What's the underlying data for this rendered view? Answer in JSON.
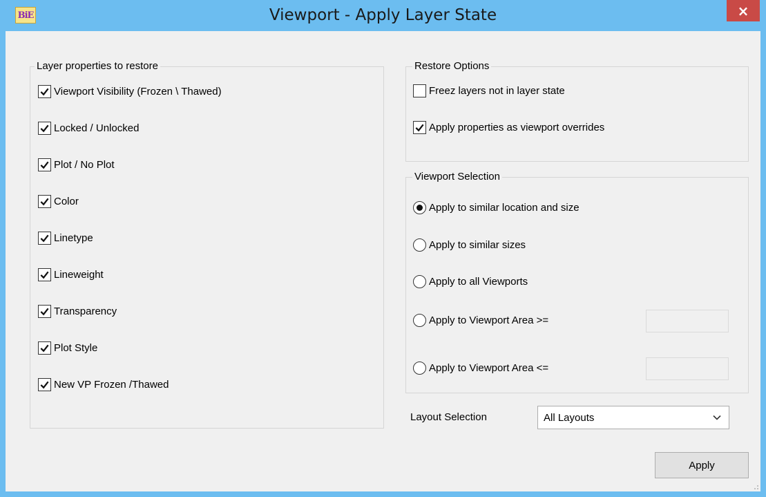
{
  "window": {
    "title": "Viewport - Apply Layer State",
    "app_icon_text": "BiE",
    "close_glyph": "×"
  },
  "layer_properties": {
    "title": "Layer properties to restore",
    "items": [
      {
        "label": "Viewport Visibility (Frozen \\ Thawed)",
        "checked": true
      },
      {
        "label": "Locked / Unlocked",
        "checked": true
      },
      {
        "label": "Plot / No Plot",
        "checked": true
      },
      {
        "label": "Color",
        "checked": true
      },
      {
        "label": "Linetype",
        "checked": true
      },
      {
        "label": "Lineweight",
        "checked": true
      },
      {
        "label": "Transparency",
        "checked": true
      },
      {
        "label": "Plot Style",
        "checked": true
      },
      {
        "label": "New VP Frozen /Thawed",
        "checked": true
      }
    ]
  },
  "restore_options": {
    "title": "Restore Options",
    "items": [
      {
        "label": "Freez layers not in layer state",
        "checked": false
      },
      {
        "label": "Apply properties as viewport overrides",
        "checked": true
      }
    ]
  },
  "viewport_selection": {
    "title": "Viewport Selection",
    "options": [
      {
        "label": "Apply to similar location and  size",
        "selected": true
      },
      {
        "label": "Apply to similar sizes",
        "selected": false
      },
      {
        "label": "Apply to all Viewports",
        "selected": false
      },
      {
        "label": "Apply to Viewport Area >=",
        "selected": false
      },
      {
        "label": "Apply to Viewport Area <=",
        "selected": false
      }
    ],
    "area_min_value": "",
    "area_max_value": ""
  },
  "layout_selection": {
    "label": "Layout Selection",
    "value": "All Layouts"
  },
  "buttons": {
    "apply": "Apply"
  },
  "colors": {
    "titlebar": "#6cbdf0",
    "close": "#c94a46",
    "client": "#f0f0f0"
  }
}
